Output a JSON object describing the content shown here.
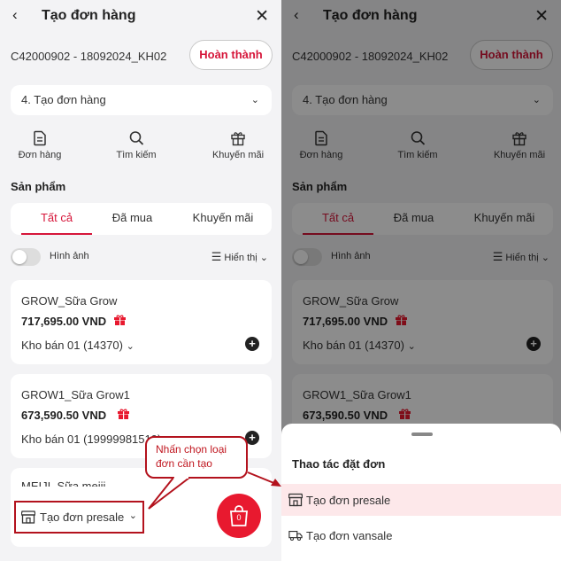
{
  "header": {
    "title": "Tạo đơn hàng",
    "back_icon": "chevron-left-icon",
    "close_icon": "close-icon"
  },
  "order": {
    "code": "C42000902 - 18092024_KH02",
    "done_label": "Hoàn thành"
  },
  "step_select": {
    "value": "4. Tạo đơn hàng"
  },
  "actions": [
    {
      "label": "Đơn hàng",
      "icon": "document-icon"
    },
    {
      "label": "Tìm kiếm",
      "icon": "search-icon"
    },
    {
      "label": "Khuyến mãi",
      "icon": "gift-icon"
    }
  ],
  "products_section": {
    "title": "Sản phẩm"
  },
  "tabs": [
    {
      "label": "Tất cả",
      "active": true
    },
    {
      "label": "Đã mua",
      "active": false
    },
    {
      "label": "Khuyến mãi",
      "active": false
    }
  ],
  "options": {
    "image_label": "Hình ảnh",
    "image_toggle_on": false,
    "display_label": "Hiển thị"
  },
  "products": [
    {
      "name": "GROW_Sữa Grow",
      "price": "717,695.00 VND",
      "stock": "Kho bán 01 (14370)"
    },
    {
      "name": "GROW1_Sữa Grow1",
      "price": "673,590.50 VND",
      "stock": "Kho bán 01 (19999981519)"
    },
    {
      "name": "MEIJI_Sữa meiji"
    }
  ],
  "order_type": {
    "selected": "Tạo đơn presale"
  },
  "cart": {
    "count": "0"
  },
  "callout": {
    "line1": "Nhấn chọn loại",
    "line2": "đơn cần tạo"
  },
  "sheet": {
    "title": "Thao tác đặt đơn",
    "items": [
      {
        "label": "Tạo đơn presale",
        "icon": "store-icon",
        "highlighted": true
      },
      {
        "label": "Tạo đơn vansale",
        "icon": "truck-icon",
        "highlighted": false
      }
    ]
  },
  "colors": {
    "accent": "#d6163a",
    "callout": "#b3121d",
    "cart": "#e8192f",
    "highlight": "#fde8ea"
  }
}
